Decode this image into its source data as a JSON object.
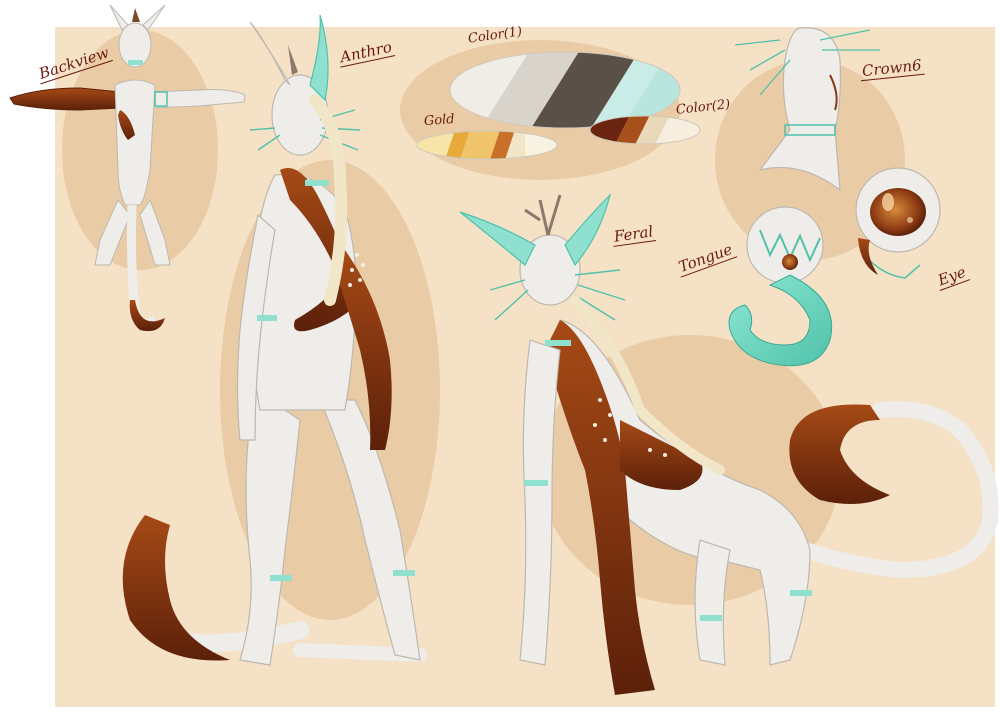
{
  "labels": {
    "backview": "Backview",
    "anthro": "Anthro",
    "color1": "Color(1)",
    "color2": "Color(2)",
    "gold": "Gold",
    "crown": "Crown6",
    "feral": "Feral",
    "tongue": "Tongue",
    "eye": "Eye"
  },
  "palettes": {
    "color1": [
      "#f0ede7",
      "#d8d4cc",
      "#5a5048",
      "#c9ede6",
      "#b8e6df"
    ],
    "gold": [
      "#f6e4a8",
      "#e6a93a",
      "#c8702a",
      "#f2e6c8",
      "#f7f2e2"
    ],
    "color2": [
      "#6b2410",
      "#a8501c",
      "#e9d9b9",
      "#f6efe0"
    ]
  },
  "colors": {
    "background": "#f5e1c5",
    "backdrop_circle": "#e9cca6",
    "body": "#efedea",
    "body_outline": "#cfcac4",
    "brown": "#8a3a12",
    "dark_brown": "#5c200a",
    "mint": "#8fe0cf",
    "mint_dark": "#4fc2aa",
    "label": "#6b1a10"
  }
}
